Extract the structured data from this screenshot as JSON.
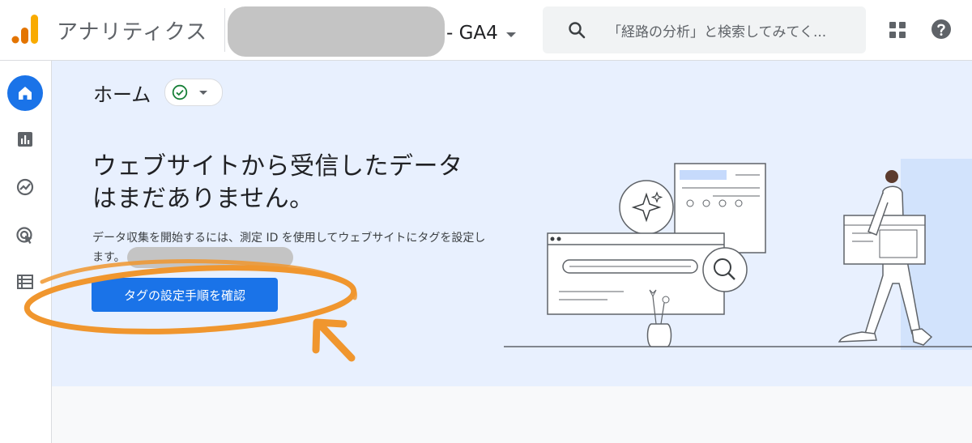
{
  "header": {
    "product_name": "アナリティクス",
    "property_suffix": "- GA4",
    "search": {
      "placeholder": "「経路の分析」と検索してみてく..."
    }
  },
  "page": {
    "title": "ホーム",
    "headline": "ウェブサイトから受信したデータはまだありません。",
    "description": "データ収集を開始するには、測定 ID を使用してウェブサイトにタグを設定します。",
    "cta_label": "タグの設定手順を確認"
  },
  "colors": {
    "accent": "#1a73e8",
    "main_bg": "#e8f0fe",
    "annotation": "#f0962e",
    "logo_orange": "#f9ab00",
    "logo_dark_orange": "#e37400"
  },
  "icons": {
    "header": [
      "analytics-logo",
      "search-icon",
      "apps-icon",
      "help-icon"
    ],
    "rail": [
      "home-icon",
      "reports-icon",
      "explore-icon",
      "advertising-icon",
      "configure-icon"
    ]
  }
}
